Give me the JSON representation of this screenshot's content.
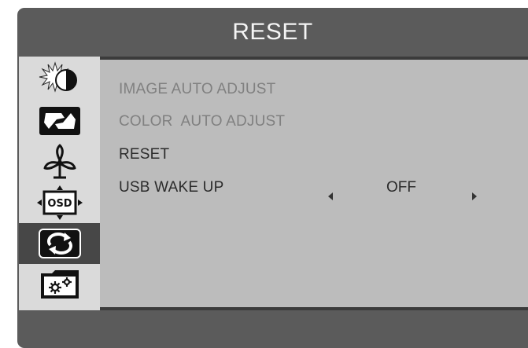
{
  "osd": {
    "title": "RESET",
    "colors": {
      "frame": "#5b5b5b",
      "panel": "#bcbcbc",
      "sidebar": "#dadada",
      "sidebar_selected": "#474747"
    },
    "sidebar": {
      "items": [
        {
          "icon": "brightness-contrast-icon",
          "selected": false
        },
        {
          "icon": "picture-size-icon",
          "selected": false
        },
        {
          "icon": "eco-fan-icon",
          "selected": false
        },
        {
          "icon": "osd-position-icon",
          "label": "OSD",
          "selected": false
        },
        {
          "icon": "reset-arrows-icon",
          "selected": true
        },
        {
          "icon": "settings-gears-icon",
          "selected": false
        }
      ]
    },
    "menu": {
      "items": [
        {
          "label": "IMAGE AUTO ADJUST",
          "enabled": false
        },
        {
          "label": "COLOR  AUTO ADJUST",
          "enabled": false
        },
        {
          "label": "RESET",
          "enabled": true
        },
        {
          "label": "USB WAKE UP",
          "enabled": true,
          "value": "OFF"
        }
      ]
    }
  }
}
